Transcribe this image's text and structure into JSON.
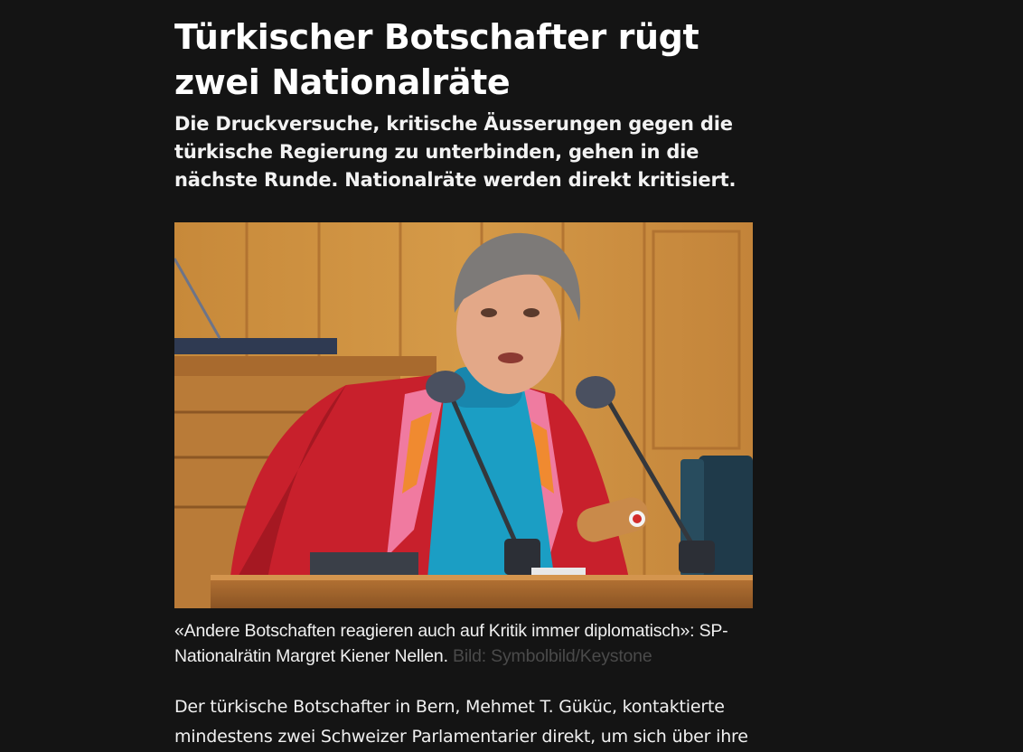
{
  "article": {
    "headline": "Türkischer Botschafter rügt zwei Nationalräte",
    "lead": "Die Druckversuche, kritische Äusserungen gegen die türkische Regierung zu unterbinden, gehen in die nächste Runde. Nationalräte werden direkt kritisiert.",
    "image": {
      "caption": "«Andere Botschaften reagieren auch auf Kritik immer diplomatisch»: SP-Nationalrätin Margret Kiener Nellen.",
      "credit": "Bild: Symbolbild/Keystone"
    },
    "body": "Der türkische Botschafter in Bern, Mehmet T. Güküc, kontaktierte mindestens zwei Schweizer Parlamentarier direkt, um sich über ihre"
  },
  "colors": {
    "background": "#141414",
    "text": "#ffffff",
    "credit": "#4a4a4a"
  }
}
